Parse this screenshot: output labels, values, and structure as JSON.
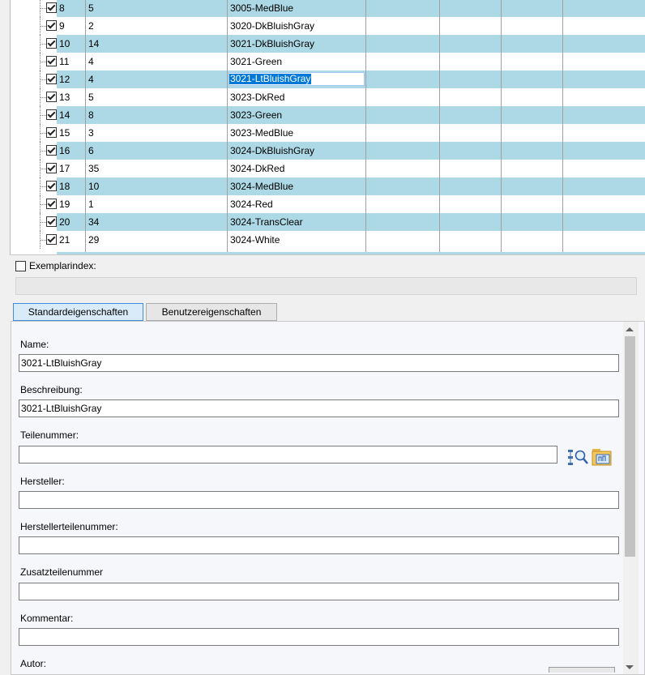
{
  "grid": {
    "rows": [
      {
        "index": "8",
        "qty": "5",
        "name": "3005-MedBlue",
        "alt": true
      },
      {
        "index": "9",
        "qty": "2",
        "name": "3020-DkBluishGray",
        "alt": false
      },
      {
        "index": "10",
        "qty": "14",
        "name": "3021-DkBluishGray",
        "alt": true
      },
      {
        "index": "11",
        "qty": "4",
        "name": "3021-Green",
        "alt": false
      },
      {
        "index": "12",
        "qty": "4",
        "name": "3021-LtBluishGray",
        "alt": true,
        "selected": true
      },
      {
        "index": "13",
        "qty": "5",
        "name": "3023-DkRed",
        "alt": false
      },
      {
        "index": "14",
        "qty": "8",
        "name": "3023-Green",
        "alt": true
      },
      {
        "index": "15",
        "qty": "3",
        "name": "3023-MedBlue",
        "alt": false
      },
      {
        "index": "16",
        "qty": "6",
        "name": "3024-DkBluishGray",
        "alt": true
      },
      {
        "index": "17",
        "qty": "35",
        "name": "3024-DkRed",
        "alt": false
      },
      {
        "index": "18",
        "qty": "10",
        "name": "3024-MedBlue",
        "alt": true
      },
      {
        "index": "19",
        "qty": "1",
        "name": "3024-Red",
        "alt": false
      },
      {
        "index": "20",
        "qty": "34",
        "name": "3024-TransClear",
        "alt": true
      },
      {
        "index": "21",
        "qty": "29",
        "name": "3024-White",
        "alt": false
      }
    ],
    "row_color": "#add8e6"
  },
  "exemplar": {
    "label": "Exemplarindex:"
  },
  "tabs": {
    "standard": "Standardeigenschaften",
    "user": "Benutzereigenschaften"
  },
  "properties": {
    "name_label": "Name:",
    "name_value": "3021-LtBluishGray",
    "description_label": "Beschreibung:",
    "description_value": "3021-LtBluishGray",
    "part_number_label": "Teilenummer:",
    "part_number_value": "",
    "manufacturer_label": "Hersteller:",
    "manufacturer_value": "",
    "manufacturer_part_label": "Herstellerteilenummer:",
    "manufacturer_part_value": "",
    "additional_part_label": "Zusatzteilenummer",
    "additional_part_value": "",
    "comment_label": "Kommentar:",
    "comment_value": "",
    "author_label": "Autor:"
  },
  "icons": {
    "search": "search-tree-icon",
    "browse": "browse-folder-icon"
  }
}
